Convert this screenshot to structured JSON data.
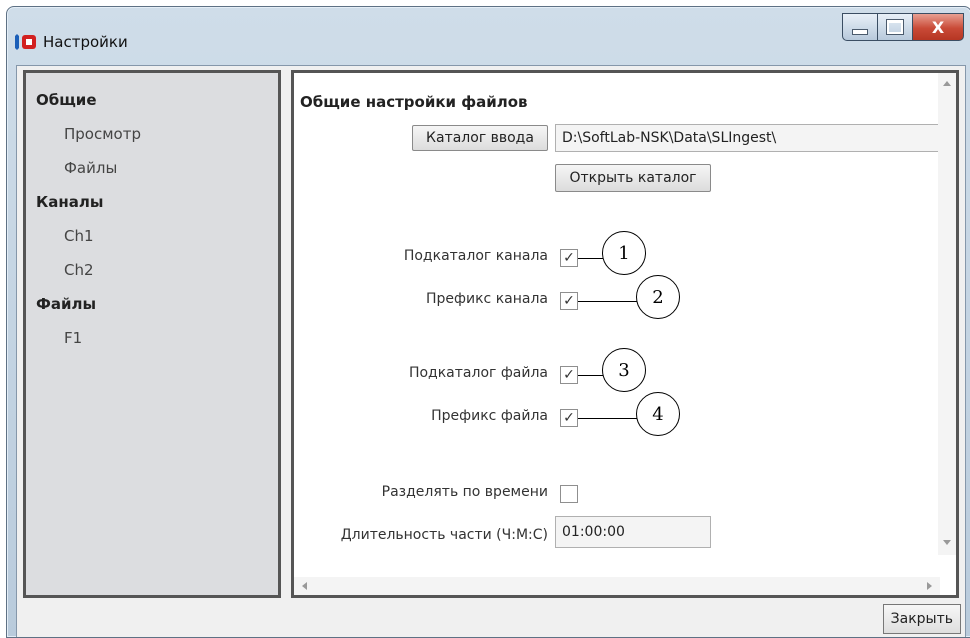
{
  "window": {
    "title": "Настройки",
    "controls": {
      "minimize_icon": "minimize-icon",
      "maximize_icon": "maximize-icon",
      "close_glyph": "X"
    }
  },
  "sidebar": {
    "items": [
      {
        "label": "Общие",
        "level": "group"
      },
      {
        "label": "Просмотр",
        "level": "sub"
      },
      {
        "label": "Файлы",
        "level": "sub"
      },
      {
        "label": "Каналы",
        "level": "group"
      },
      {
        "label": "Ch1",
        "level": "sub"
      },
      {
        "label": "Ch2",
        "level": "sub"
      },
      {
        "label": "Файлы",
        "level": "group"
      },
      {
        "label": "F1",
        "level": "sub"
      }
    ]
  },
  "main": {
    "section_title": "Общие настройки файлов",
    "input_dir_button": "Каталог ввода",
    "input_dir_value": "D:\\SoftLab-NSK\\Data\\SLIngest\\",
    "open_dir_button": "Открыть каталог",
    "options": [
      {
        "label": "Подкаталог канала",
        "checked": true,
        "callout": "1"
      },
      {
        "label": "Префикс канала",
        "checked": true,
        "callout": "2"
      },
      {
        "label": "Подкаталог файла",
        "checked": true,
        "callout": "3"
      },
      {
        "label": "Префикс файла",
        "checked": true,
        "callout": "4"
      },
      {
        "label": "Разделять по времени",
        "checked": false
      }
    ],
    "duration_label": "Длительность части (Ч:М:С)",
    "duration_value": "01:00:00"
  },
  "footer": {
    "close_button": "Закрыть"
  },
  "colors": {
    "accent_close": "#c94a37",
    "panel_border": "#555555",
    "sidebar_bg": "#dcdde0"
  }
}
